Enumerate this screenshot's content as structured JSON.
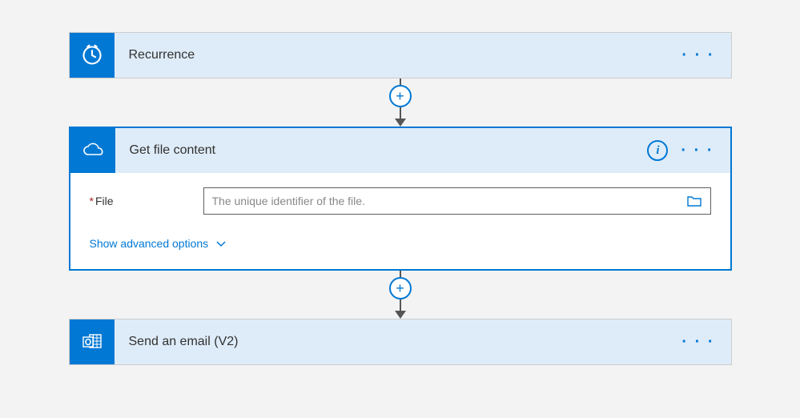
{
  "flow": {
    "steps": [
      {
        "title": "Recurrence",
        "icon": "clock-icon"
      },
      {
        "title": "Get file content",
        "icon": "onedrive-icon",
        "fields": {
          "file": {
            "label": "File",
            "required": true,
            "placeholder": "The unique identifier of the file.",
            "value": ""
          }
        },
        "advanced_link": "Show advanced options"
      },
      {
        "title": "Send an email (V2)",
        "icon": "outlook-icon"
      }
    ]
  }
}
